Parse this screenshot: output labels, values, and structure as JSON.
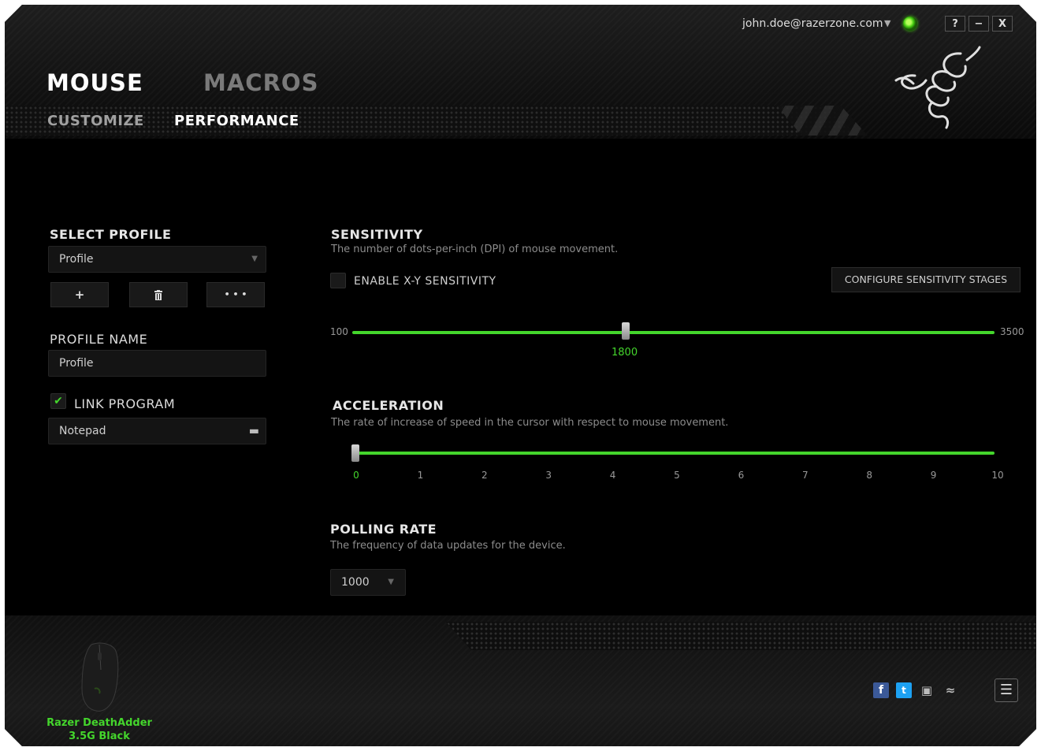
{
  "header": {
    "account_email": "john.doe@razerzone.com",
    "account_arrow": "▼",
    "window_buttons": {
      "help": "?",
      "minimize": "−",
      "close": "X"
    },
    "main_tabs": [
      {
        "label": "MOUSE",
        "active": true
      },
      {
        "label": "MACROS",
        "active": false
      }
    ],
    "sub_tabs": [
      {
        "label": "CUSTOMIZE",
        "active": false
      },
      {
        "label": "PERFORMANCE",
        "active": true
      }
    ],
    "status_color": "#44d62c"
  },
  "left_panel": {
    "select_profile_title": "SELECT PROFILE",
    "profile_selected": "Profile",
    "add_button": "+",
    "delete_icon": "trash-icon",
    "more_button": "• • •",
    "profile_name_title": "PROFILE NAME",
    "profile_name_value": "Profile",
    "link_program_label": "LINK PROGRAM",
    "link_program_checked": true,
    "linked_program": "Notepad"
  },
  "sensitivity": {
    "title": "SENSITIVITY",
    "description": "The number of dots-per-inch (DPI) of mouse movement.",
    "enable_xy_label": "ENABLE X-Y SENSITIVITY",
    "enable_xy_checked": false,
    "configure_button": "CONFIGURE SENSITIVITY STAGES",
    "min": "100",
    "max": "3500",
    "value": "1800"
  },
  "acceleration": {
    "title": "ACCELERATION",
    "description": "The rate of increase of speed in the cursor with respect to mouse movement.",
    "ticks": [
      "0",
      "1",
      "2",
      "3",
      "4",
      "5",
      "6",
      "7",
      "8",
      "9",
      "10"
    ],
    "value": 0
  },
  "polling_rate": {
    "title": "POLLING RATE",
    "description": "The frequency of data updates for the device.",
    "selected": "1000"
  },
  "footer": {
    "device_name_line1": "Razer DeathAdder",
    "device_name_line2": "3.5G Black",
    "social_icons": [
      "facebook-icon",
      "twitter-icon",
      "store-icon",
      "razer-icon"
    ],
    "menu_icon": "☰",
    "accent_color": "#44d62c"
  }
}
